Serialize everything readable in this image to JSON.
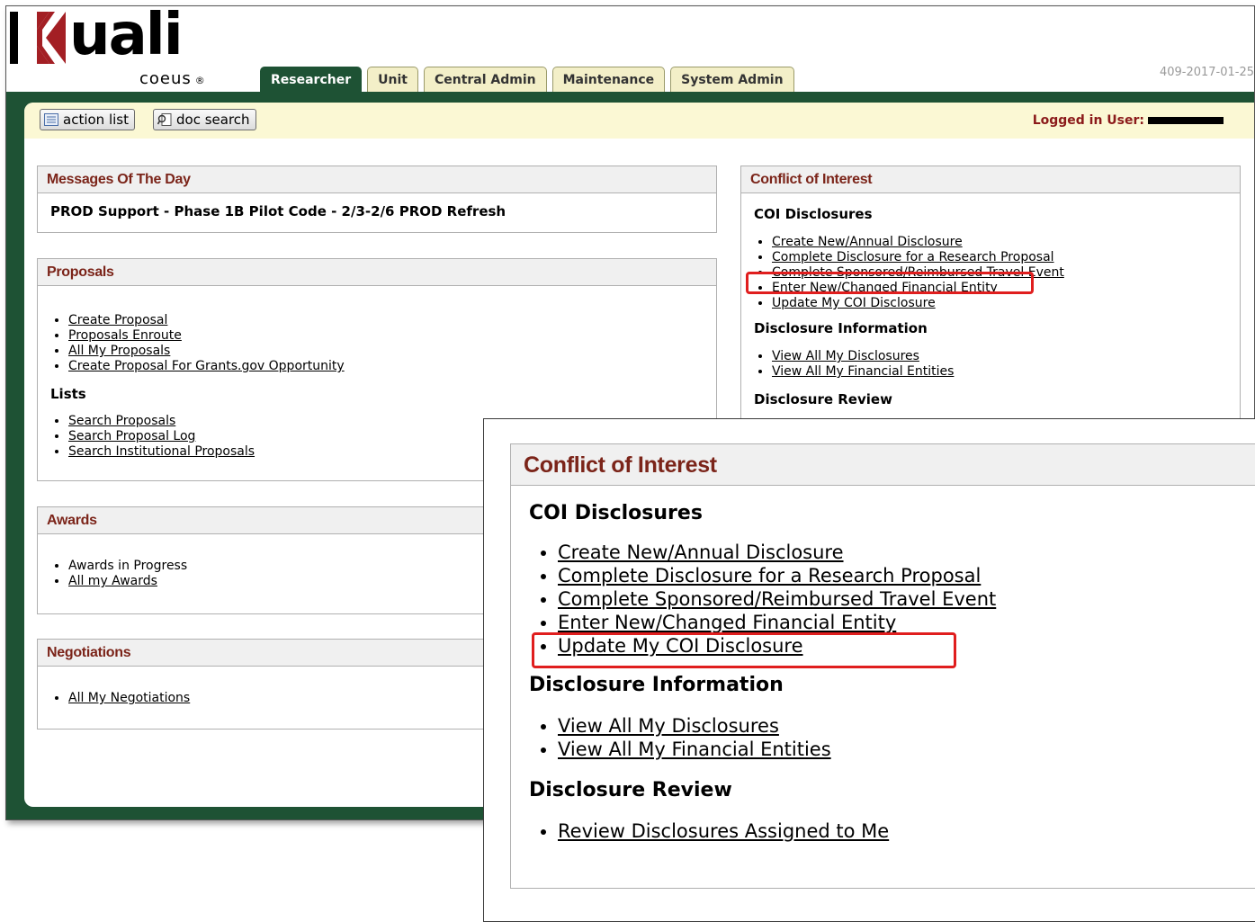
{
  "header": {
    "logo_text": "uali",
    "logo_sub": "coeus",
    "logo_reg": "®",
    "version": "409-2017-01-25",
    "tabs": [
      "Researcher",
      "Unit",
      "Central Admin",
      "Maintenance",
      "System Admin"
    ],
    "active_tab": "Researcher"
  },
  "toolbar": {
    "action_list": "action list",
    "doc_search": "doc search",
    "logged_in_label": "Logged in User:"
  },
  "messages": {
    "title": "Messages Of The Day",
    "text": "PROD Support - Phase 1B Pilot Code - 2/3-2/6 PROD Refresh"
  },
  "proposals": {
    "title": "Proposals",
    "links": [
      "Create Proposal",
      "Proposals Enroute",
      "All My Proposals",
      "Create Proposal For Grants.gov Opportunity"
    ],
    "lists_heading": "Lists",
    "lists": [
      "Search Proposals",
      "Search Proposal Log",
      "Search Institutional Proposals"
    ]
  },
  "awards": {
    "title": "Awards",
    "items": [
      "Awards in Progress",
      "All my Awards"
    ]
  },
  "negotiations": {
    "title": "Negotiations",
    "items": [
      "All My Negotiations"
    ]
  },
  "coi": {
    "title": "Conflict of Interest",
    "disclosures_heading": "COI Disclosures",
    "disclosures": [
      "Create New/Annual Disclosure",
      "Complete Disclosure for a Research Proposal",
      "Complete Sponsored/Reimbursed Travel Event",
      "Enter New/Changed Financial Entity",
      "Update My COI Disclosure"
    ],
    "info_heading": "Disclosure Information",
    "info": [
      "View All My Disclosures",
      "View All My Financial Entities"
    ],
    "review_heading": "Disclosure Review",
    "review": [
      "Review Disclosures Assigned to Me"
    ]
  },
  "colors": {
    "brand_green": "#1e5234",
    "tab_bg": "#f3efc8",
    "header_text": "#7b2419",
    "highlight": "#e01e1e",
    "logo_red": "#a31f24"
  }
}
